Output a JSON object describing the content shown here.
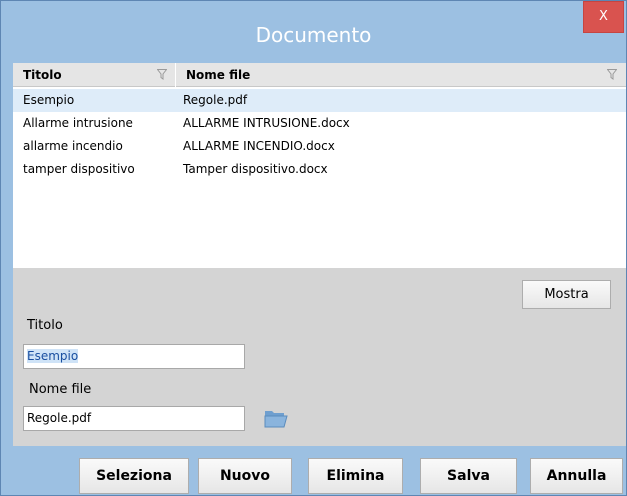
{
  "window": {
    "title": "Documento",
    "close_label": "X"
  },
  "grid": {
    "columns": [
      "Titolo",
      "Nome file"
    ],
    "rows": [
      {
        "titolo": "Esempio",
        "nome_file": "Regole.pdf",
        "selected": true
      },
      {
        "titolo": "Allarme intrusione",
        "nome_file": "ALLARME INTRUSIONE.docx",
        "selected": false
      },
      {
        "titolo": "allarme incendio",
        "nome_file": "ALLARME INCENDIO.docx",
        "selected": false
      },
      {
        "titolo": "tamper dispositivo",
        "nome_file": "Tamper dispositivo.docx",
        "selected": false
      }
    ]
  },
  "form": {
    "mostra_label": "Mostra",
    "titolo_label": "Titolo",
    "titolo_value": "Esempio",
    "nome_file_label": "Nome file",
    "nome_file_value": "Regole.pdf",
    "browse_icon": "folder-open-icon"
  },
  "footer": {
    "seleziona": "Seleziona",
    "nuovo": "Nuovo",
    "elimina": "Elimina",
    "salva": "Salva",
    "annulla": "Annulla"
  },
  "colors": {
    "title_bar": "#9cc0e2",
    "close_button": "#d9534f",
    "selected_row": "#deecf9",
    "panel": "#d4d4d4"
  }
}
